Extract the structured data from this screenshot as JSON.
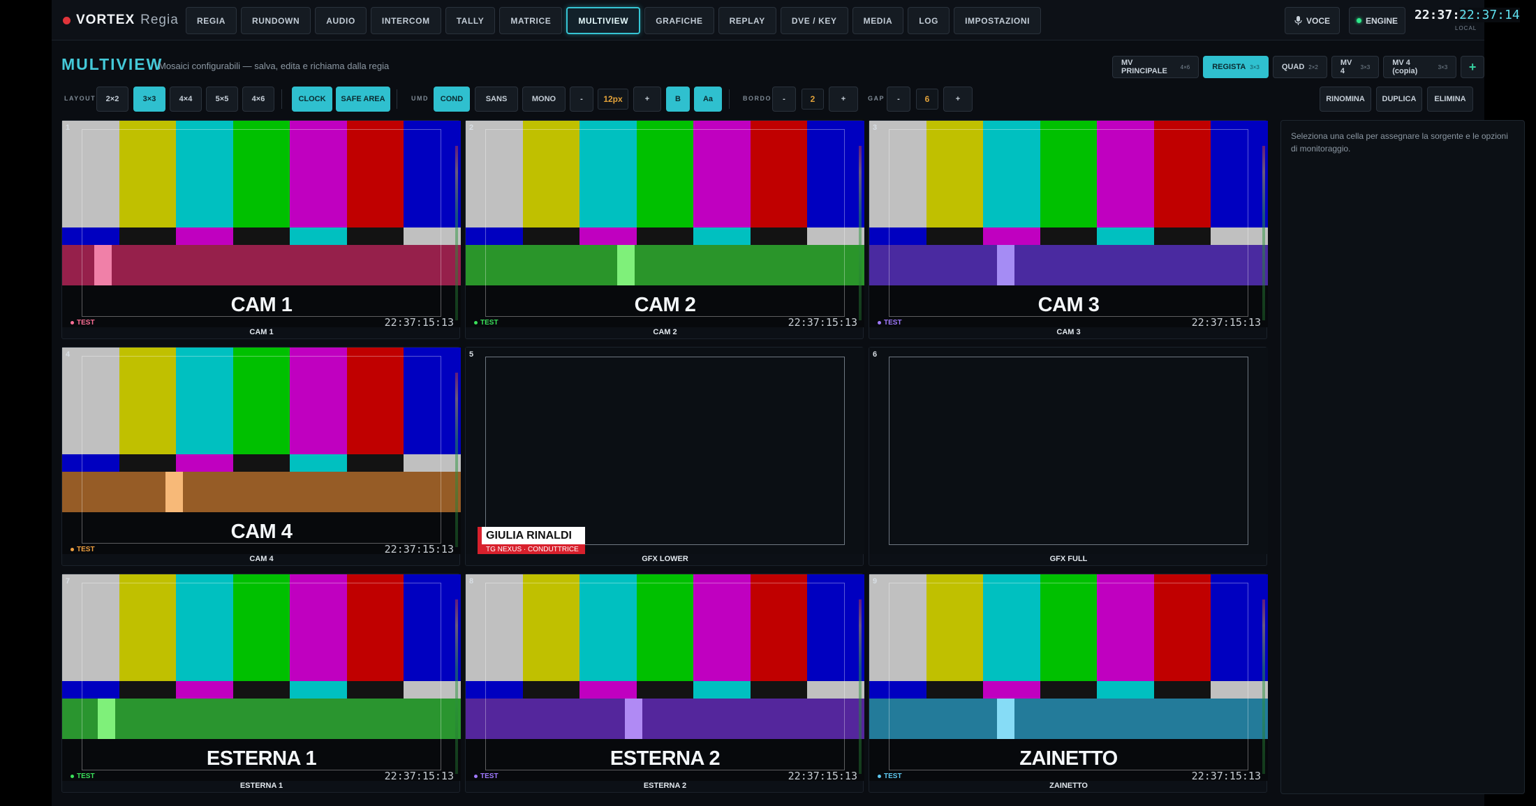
{
  "app": {
    "brand": "VORTEX",
    "brand_sub": "Regia"
  },
  "nav": [
    "REGIA",
    "RUNDOWN",
    "AUDIO",
    "INTERCOM",
    "TALLY",
    "MATRICE",
    "MULTIVIEW",
    "GRAFICHE",
    "REPLAY",
    "DVE / KEY",
    "MEDIA",
    "LOG",
    "IMPOSTAZIONI"
  ],
  "nav_active": "MULTIVIEW",
  "header_right": {
    "voce": "VOCE",
    "engine": "ENGINE",
    "clock": "22:37:1",
    "clock_overlay": "22:37:14",
    "clock_label": "LOCAL"
  },
  "section": {
    "title": "MULTIVIEW",
    "subtitle": "Mosaici configurabili — salva, edita e richiama dalla regia"
  },
  "presets": [
    {
      "name": "MV PRINCIPALE",
      "dim": "4×6"
    },
    {
      "name": "REGISTA",
      "dim": "3×3",
      "active": true
    },
    {
      "name": "QUAD",
      "dim": "2×2"
    },
    {
      "name": "MV 4",
      "dim": "3×3"
    },
    {
      "name": "MV 4 (copia)",
      "dim": "3×3"
    },
    {
      "name": "+"
    }
  ],
  "toolbar": {
    "layout_label": "LAYOUT",
    "layouts": [
      "2×2",
      "3×3",
      "4×4",
      "5×5",
      "4×6"
    ],
    "clock": "CLOCK",
    "safe_area": "SAFE AREA",
    "umd_label": "UMD",
    "fonts": [
      "COND",
      "SANS",
      "MONO"
    ],
    "minus": "-",
    "size": "12px",
    "plus": "+",
    "bold": "B",
    "case": "Aa",
    "bordo_label": "BORDO",
    "bordo": "2",
    "gap_label": "GAP",
    "gap": "6",
    "rename": "RINOMINA",
    "duplicate": "DUPLICA",
    "delete": "ELIMINA"
  },
  "colors": {
    "accent": "#2fc0cf",
    "bars": [
      "#c0c0c0",
      "#c0c000",
      "#00c0c0",
      "#00c000",
      "#c000c0",
      "#c00000",
      "#0000c0"
    ],
    "mid": [
      "#0000c0",
      "#131313",
      "#c000c0",
      "#131313",
      "#00c0c0",
      "#131313",
      "#c0c0c0"
    ]
  },
  "cells": [
    {
      "n": "1",
      "type": "cam",
      "name": "CAM 1",
      "label": "CAM 1",
      "tag": "TEST",
      "tag_color": "#ff6f96",
      "tc": "22:37:15:13",
      "band": "#96204b",
      "pluge": "#f080a8",
      "pluge_x": 0.08
    },
    {
      "n": "2",
      "type": "cam",
      "name": "CAM 2",
      "label": "CAM 2",
      "tag": "TEST",
      "tag_color": "#3ae05a",
      "tc": "22:37:15:13",
      "band": "#2a952a",
      "pluge": "#7ff07a",
      "pluge_x": 0.38
    },
    {
      "n": "3",
      "type": "cam",
      "name": "CAM 3",
      "label": "CAM 3",
      "tag": "TEST",
      "tag_color": "#a07aff",
      "tc": "22:37:15:13",
      "band": "#4a2aa0",
      "pluge": "#a58cf4",
      "pluge_x": 0.32
    },
    {
      "n": "4",
      "type": "cam",
      "name": "CAM 4",
      "label": "CAM 4",
      "tag": "TEST",
      "tag_color": "#f0a040",
      "tc": "22:37:15:13",
      "band": "#965c26",
      "pluge": "#f7b978",
      "pluge_x": 0.26
    },
    {
      "n": "5",
      "type": "gfx-lower",
      "label": "GFX LOWER",
      "lower_name": "GIULIA RINALDI",
      "lower_role": "TG NEXUS · CONDUTTRICE"
    },
    {
      "n": "6",
      "type": "gfx-full",
      "label": "GFX FULL"
    },
    {
      "n": "7",
      "type": "cam",
      "name": "ESTERNA 1",
      "label": "ESTERNA 1",
      "tag": "TEST",
      "tag_color": "#3ae05a",
      "tc": "22:37:15:13",
      "band": "#2a952f",
      "pluge": "#7ff07a",
      "pluge_x": 0.09
    },
    {
      "n": "8",
      "type": "cam",
      "name": "ESTERNA 2",
      "label": "ESTERNA 2",
      "tag": "TEST",
      "tag_color": "#a07aff",
      "tc": "22:37:15:13",
      "band": "#54269c",
      "pluge": "#b08af4",
      "pluge_x": 0.4
    },
    {
      "n": "9",
      "type": "cam",
      "name": "ZAINETTO",
      "label": "ZAINETTO",
      "tag": "TEST",
      "tag_color": "#5ec8f0",
      "tc": "22:37:15:13",
      "band": "#237b9a",
      "pluge": "#86dcf6",
      "pluge_x": 0.32
    }
  ],
  "side_panel": {
    "hint": "Seleziona una cella per assegnare la sorgente e le opzioni di monitoraggio."
  }
}
